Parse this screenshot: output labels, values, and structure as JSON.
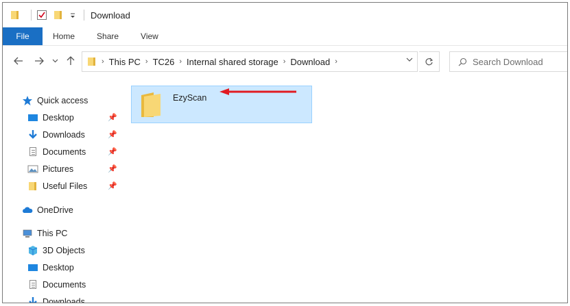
{
  "window": {
    "title": "Download"
  },
  "ribbon": {
    "tabs": [
      "File",
      "Home",
      "Share",
      "View"
    ]
  },
  "address": {
    "crumbs": [
      "This PC",
      "TC26",
      "Internal shared storage",
      "Download"
    ]
  },
  "search": {
    "placeholder": "Search Download"
  },
  "nav": {
    "quick_access": "Quick access",
    "quick_items": [
      "Desktop",
      "Downloads",
      "Documents",
      "Pictures",
      "Useful Files"
    ],
    "onedrive": "OneDrive",
    "this_pc": "This PC",
    "pc_items": [
      "3D Objects",
      "Desktop",
      "Documents",
      "Downloads"
    ]
  },
  "content": {
    "items": [
      {
        "name": "EzyScan",
        "type": "folder",
        "selected": true
      }
    ]
  },
  "colors": {
    "accent": "#1a6fc4",
    "selection": "#cce8ff",
    "arrow": "#e11b22",
    "folder": "#f8d775"
  }
}
